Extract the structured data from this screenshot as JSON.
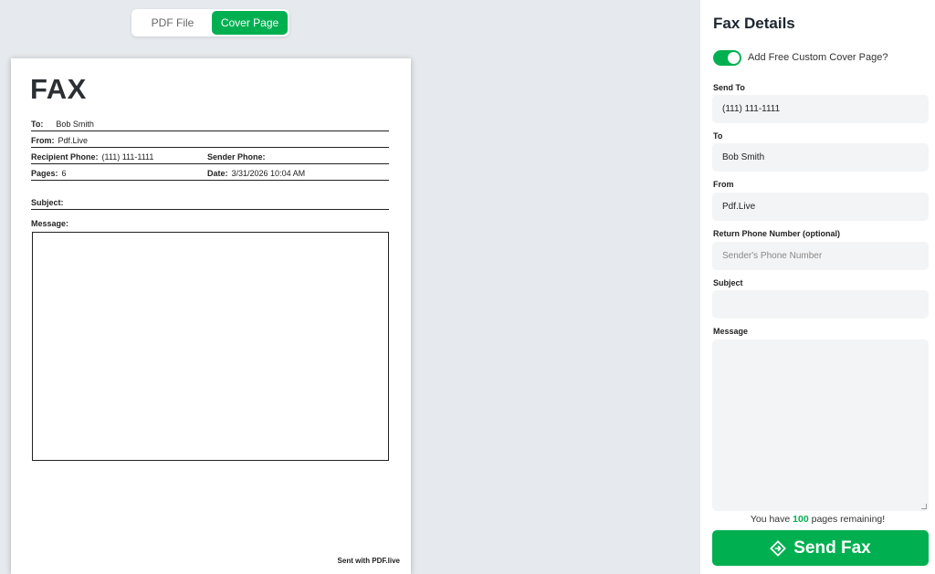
{
  "tabs": {
    "pdf_label": "PDF File",
    "cover_label": "Cover Page"
  },
  "cover": {
    "title": "FAX",
    "to_label": "To:",
    "to_value": "Bob Smith",
    "from_label": "From:",
    "from_value": "Pdf.Live",
    "recipient_phone_label": "Recipient Phone:",
    "recipient_phone_value": "(111) 111-1111",
    "sender_phone_label": "Sender Phone:",
    "pages_label": "Pages:",
    "pages_value": "6",
    "date_label": "Date:",
    "date_value": "3/31/2026 10:04 AM",
    "subject_label": "Subject:",
    "message_label": "Message:",
    "footer": "Sent with PDF.live"
  },
  "panel": {
    "title": "Fax Details",
    "toggle_label": "Add Free Custom Cover Page?",
    "send_to_label": "Send To",
    "send_to_value": "(111) 111-1111",
    "to_label": "To",
    "to_value": "Bob Smith",
    "from_label": "From",
    "from_value": "Pdf.Live",
    "return_label": "Return Phone Number (optional)",
    "return_placeholder": "Sender's Phone Number",
    "subject_label": "Subject",
    "message_label": "Message",
    "remaining_prefix": "You have",
    "remaining_count": "100",
    "remaining_suffix": "pages remaining!",
    "send_label": "Send Fax"
  },
  "colors": {
    "accent": "#00b050"
  }
}
